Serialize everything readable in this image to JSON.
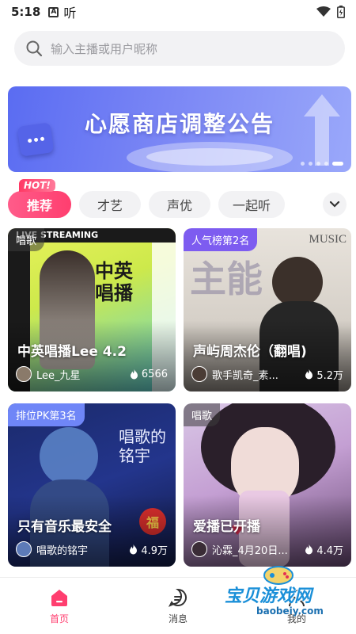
{
  "status_bar": {
    "time": "5:18",
    "indicator_a": "A",
    "indicator_char": "听"
  },
  "search": {
    "placeholder": "输入主播或用户昵称"
  },
  "banner": {
    "title": "心愿商店调整公告",
    "total_slides": 5,
    "active_slide": 1
  },
  "tabs": {
    "hot_badge": "HOT!",
    "items": [
      {
        "label": "推荐",
        "active": true
      },
      {
        "label": "才艺",
        "active": false
      },
      {
        "label": "声优",
        "active": false
      },
      {
        "label": "一起听",
        "active": false
      }
    ]
  },
  "cards": [
    {
      "badge": "唱歌",
      "badge_style": "grey",
      "title": "中英唱播Lee 4.2",
      "host": "Lee_九星",
      "heat": "6566",
      "art_text": "中英唱播",
      "art_tag": "LIVE STREAMING"
    },
    {
      "badge": "人气榜第2名",
      "badge_style": "purple",
      "title": "声屿周杰伦（翻唱)",
      "host": "歌手凯奇_素...",
      "heat": "5.2万",
      "art_text": "主能",
      "art_tag": "MUSIC"
    },
    {
      "badge": "排位PK第3名",
      "badge_style": "blue",
      "title": "只有音乐最安全",
      "host": "唱歌的铭宇",
      "heat": "4.9万",
      "art_text": "唱歌的铭宇",
      "art_tag": "福"
    },
    {
      "badge": "唱歌",
      "badge_style": "grey",
      "title": "爱播已开播",
      "host": "沁霖_4月20日...",
      "heat": "4.4万",
      "art_text": "",
      "art_tag": ""
    }
  ],
  "bottom_nav": [
    {
      "label": "首页",
      "active": true,
      "icon": "home-icon"
    },
    {
      "label": "消息",
      "active": false,
      "icon": "message-icon"
    },
    {
      "label": "我的",
      "active": false,
      "icon": "profile-icon"
    }
  ],
  "watermark": {
    "text": "宝贝游戏网",
    "url": "baobeiy.com"
  },
  "colors": {
    "accent": "#ff3e6f",
    "banner": "#6a78f3",
    "badge_purple": "#7d5cf0",
    "badge_blue": "#6f86f7"
  }
}
